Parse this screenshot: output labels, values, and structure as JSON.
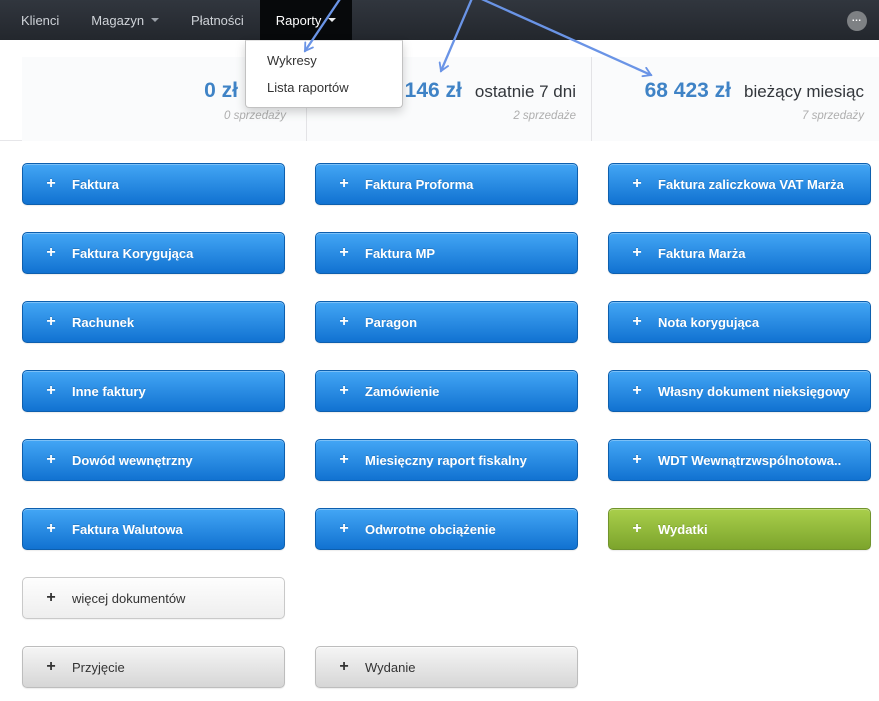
{
  "navbar": {
    "items": [
      {
        "label": "Klienci",
        "has_caret": false,
        "active": false
      },
      {
        "label": "Magazyn",
        "has_caret": true,
        "active": false
      },
      {
        "label": "Płatności",
        "has_caret": false,
        "active": false
      },
      {
        "label": "Raporty",
        "has_caret": true,
        "active": true
      }
    ],
    "overflow_label": "…"
  },
  "reports_dropdown": {
    "items": [
      {
        "label": "Wykresy"
      },
      {
        "label": "Lista raportów"
      }
    ]
  },
  "stats": [
    {
      "value": "0 zł",
      "label": "",
      "sales": "0 sprzedaży"
    },
    {
      "value": "146 zł",
      "label": "ostatnie 7 dni",
      "sales": "2 sprzedaże"
    },
    {
      "value": "68 423 zł",
      "label": "bieżący miesiąc",
      "sales": "7 sprzedaży"
    }
  ],
  "buttons": {
    "plus_icon": "+",
    "items": [
      {
        "label": "Faktura",
        "variant": "blue",
        "col": 1,
        "row": 1
      },
      {
        "label": "Faktura Proforma",
        "variant": "blue",
        "col": 2,
        "row": 1
      },
      {
        "label": "Faktura zaliczkowa VAT Marża",
        "variant": "blue",
        "col": 3,
        "row": 1
      },
      {
        "label": "Faktura Korygująca",
        "variant": "blue",
        "col": 1,
        "row": 2
      },
      {
        "label": "Faktura MP",
        "variant": "blue",
        "col": 2,
        "row": 2
      },
      {
        "label": "Faktura Marża",
        "variant": "blue",
        "col": 3,
        "row": 2
      },
      {
        "label": "Rachunek",
        "variant": "blue",
        "col": 1,
        "row": 3
      },
      {
        "label": "Paragon",
        "variant": "blue",
        "col": 2,
        "row": 3
      },
      {
        "label": "Nota korygująca",
        "variant": "blue",
        "col": 3,
        "row": 3
      },
      {
        "label": "Inne faktury",
        "variant": "blue",
        "col": 1,
        "row": 4
      },
      {
        "label": "Zamówienie",
        "variant": "blue",
        "col": 2,
        "row": 4
      },
      {
        "label": "Własny dokument nieksięgowy",
        "variant": "blue",
        "col": 3,
        "row": 4
      },
      {
        "label": "Dowód wewnętrzny",
        "variant": "blue",
        "col": 1,
        "row": 5
      },
      {
        "label": "Miesięczny raport fiskalny",
        "variant": "blue",
        "col": 2,
        "row": 5
      },
      {
        "label": "WDT Wewnątrzwspólnotowa..",
        "variant": "blue",
        "col": 3,
        "row": 5
      },
      {
        "label": "Faktura Walutowa",
        "variant": "blue",
        "col": 1,
        "row": 6
      },
      {
        "label": "Odwrotne obciążenie",
        "variant": "blue",
        "col": 2,
        "row": 6
      },
      {
        "label": "Wydatki",
        "variant": "green",
        "col": 3,
        "row": 6
      },
      {
        "label": "więcej dokumentów",
        "variant": "light",
        "col": 1,
        "row": 7
      },
      {
        "label": "Przyjęcie",
        "variant": "gray",
        "col": 1,
        "row": 8
      },
      {
        "label": "Wydanie",
        "variant": "gray",
        "col": 2,
        "row": 8
      }
    ]
  },
  "colors": {
    "navbar_bg": "#262b32",
    "navbar_active_bg": "#07090b",
    "button_blue_top": "#43a6f5",
    "button_blue_bottom": "#1172d1",
    "button_green_top": "#a9cf4b",
    "button_green_bottom": "#7ca42c",
    "stat_value_blue": "#3f83c6",
    "arrow_blue": "#6a94e6"
  }
}
